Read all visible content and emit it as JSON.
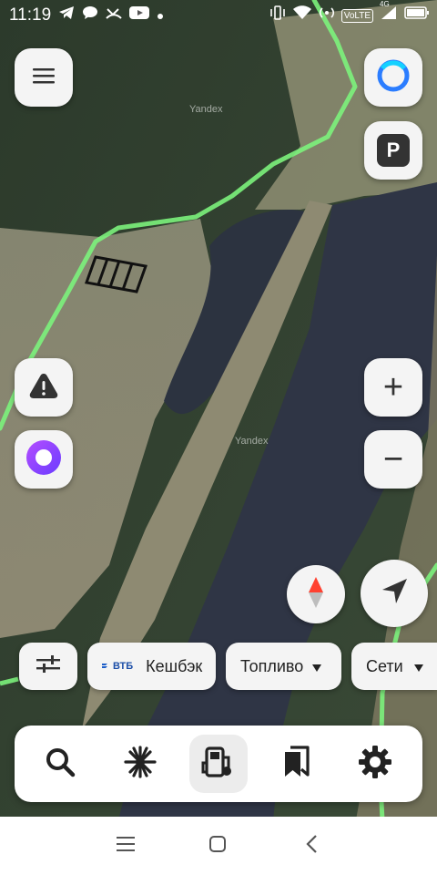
{
  "status_bar": {
    "time": "11:19",
    "notification_icons": [
      "telegram-icon",
      "chat-bubble-icon",
      "missed-call-icon",
      "youtube-icon",
      "dot-icon"
    ],
    "system_icons": [
      "vibrate-icon",
      "wifi-icon",
      "hotspot-icon",
      "volte-icon",
      "signal-icon",
      "battery-icon"
    ],
    "volte_label": "VoLTE",
    "network_label": "4G"
  },
  "map": {
    "watermark_top": "Yandex",
    "watermark_mid": "Yandex",
    "route_color": "#7CF27C",
    "river_color": "#2f3545"
  },
  "controls": {
    "menu": "menu-icon",
    "alice_top": "alice-ring-icon",
    "parking_label": "P",
    "warning": "warning-icon",
    "alice": "alice-icon",
    "zoom_in_label": "+",
    "zoom_out_label": "−",
    "compass": "compass-icon",
    "locate": "locate-arrow-icon"
  },
  "chips": {
    "filters": "sliders-icon",
    "vtb_badge": "ВТБ",
    "cashback_label": "Кешбэк",
    "fuel_label": "Топливо",
    "networks_label": "Сети"
  },
  "bottom_bar": [
    "search-icon",
    "discover-icon",
    "fuel-pump-icon",
    "bookmarks-icon",
    "settings-icon"
  ],
  "android_nav": [
    "recents-icon",
    "home-icon",
    "back-icon"
  ]
}
